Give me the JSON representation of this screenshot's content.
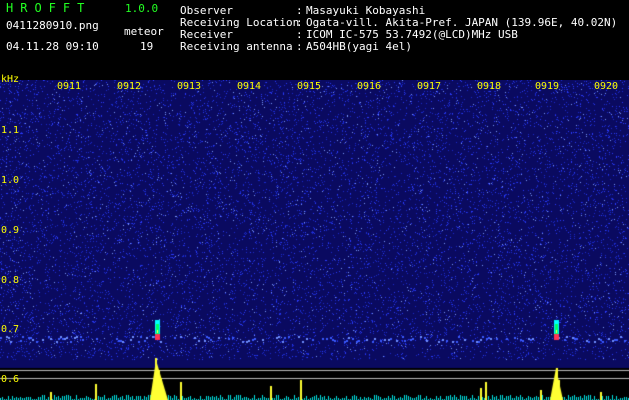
{
  "app": {
    "name": "HROFFT",
    "version": "1.0.0",
    "file_name": "0411280910.png",
    "meteor_label": "meteor",
    "date_time": "04.11.28 09:10",
    "meteor_count": "19"
  },
  "station": {
    "rows": [
      {
        "label": "Observer",
        "value": "Masayuki Kobayashi"
      },
      {
        "label": "Receiving Location",
        "value": "Ogata-vill. Akita-Pref. JAPAN (139.96E, 40.02N)"
      },
      {
        "label": "Receiver",
        "value": "ICOM IC-575 53.7492(@LCD)MHz USB"
      },
      {
        "label": "Receiving antenna",
        "value": "A504HB(yagi 4el)"
      }
    ]
  },
  "spectrogram": {
    "freq_unit": "kHz",
    "time_ticks": [
      "0911",
      "0912",
      "0913",
      "0914",
      "0915",
      "0916",
      "0917",
      "0918",
      "0919",
      "0920"
    ],
    "freq_ticks": [
      "1.1",
      "1.0",
      "0.9",
      "0.8",
      "0.7",
      "0.6"
    ],
    "colors": {
      "background": "#0a0a60",
      "noise": "#2a3cff",
      "tick_text": "#ffff00",
      "header_green": "#22ff22",
      "echo_bar": "#ffff33",
      "baseline": "#00e5e5"
    }
  }
}
